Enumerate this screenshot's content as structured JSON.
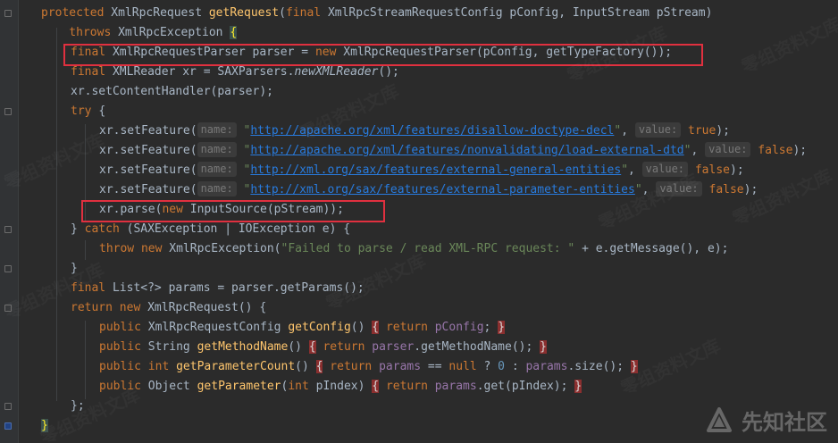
{
  "watermark_text": "零组资料文库",
  "logo_text": "先知社区",
  "lines": [
    [
      {
        "t": "protected ",
        "c": "kw"
      },
      {
        "t": "XmlRpcRequest "
      },
      {
        "t": "getRequest",
        "c": "fn"
      },
      {
        "t": "("
      },
      {
        "t": "final ",
        "c": "kw"
      },
      {
        "t": "XmlRpcStreamRequestConfig pConfig, InputStream pStream)"
      }
    ],
    [
      {
        "t": "    throws ",
        "c": "kw"
      },
      {
        "t": "XmlRpcException "
      },
      {
        "t": "{",
        "c": "brace-match"
      }
    ],
    [
      {
        "t": "final ",
        "c": "kw"
      },
      {
        "t": "XmlRpcRequestParser parser = "
      },
      {
        "t": "new ",
        "c": "kw"
      },
      {
        "t": "XmlRpcRequestParser(pConfig, getTypeFactory());"
      }
    ],
    [
      {
        "t": "final ",
        "c": "kw"
      },
      {
        "t": "XMLReader xr = SAXParsers."
      },
      {
        "t": "newXMLReader",
        "c": "italic"
      },
      {
        "t": "();"
      }
    ],
    [
      {
        "t": "xr.setContentHandler(parser);"
      }
    ],
    [
      {
        "t": "try ",
        "c": "kw"
      },
      {
        "t": "{"
      }
    ],
    [
      {
        "t": "xr.setFeature("
      },
      {
        "t": "name:",
        "hint": true
      },
      {
        "t": " "
      },
      {
        "t": "\"",
        "c": "str"
      },
      {
        "t": "http://apache.org/xml/features/disallow-doctype-decl",
        "c": "link"
      },
      {
        "t": "\"",
        "c": "str"
      },
      {
        "t": ", "
      },
      {
        "t": "value:",
        "hint": true
      },
      {
        "t": " "
      },
      {
        "t": "true",
        "c": "kw"
      },
      {
        "t": ");"
      }
    ],
    [
      {
        "t": "xr.setFeature("
      },
      {
        "t": "name:",
        "hint": true
      },
      {
        "t": " "
      },
      {
        "t": "\"",
        "c": "str"
      },
      {
        "t": "http://apache.org/xml/features/nonvalidating/load-external-dtd",
        "c": "link"
      },
      {
        "t": "\"",
        "c": "str"
      },
      {
        "t": ", "
      },
      {
        "t": "value:",
        "hint": true
      },
      {
        "t": " "
      },
      {
        "t": "false",
        "c": "kw"
      },
      {
        "t": ");"
      }
    ],
    [
      {
        "t": "xr.setFeature("
      },
      {
        "t": "name:",
        "hint": true
      },
      {
        "t": " "
      },
      {
        "t": "\"",
        "c": "str"
      },
      {
        "t": "http://xml.org/sax/features/external-general-entities",
        "c": "link"
      },
      {
        "t": "\"",
        "c": "str"
      },
      {
        "t": ", "
      },
      {
        "t": "value:",
        "hint": true
      },
      {
        "t": " "
      },
      {
        "t": "false",
        "c": "kw"
      },
      {
        "t": ");"
      }
    ],
    [
      {
        "t": "xr.setFeature("
      },
      {
        "t": "name:",
        "hint": true
      },
      {
        "t": " "
      },
      {
        "t": "\"",
        "c": "str"
      },
      {
        "t": "http://xml.org/sax/features/external-parameter-entities",
        "c": "link"
      },
      {
        "t": "\"",
        "c": "str"
      },
      {
        "t": ", "
      },
      {
        "t": "value:",
        "hint": true
      },
      {
        "t": " "
      },
      {
        "t": "false",
        "c": "kw"
      },
      {
        "t": ");"
      }
    ],
    [
      {
        "t": "xr.parse("
      },
      {
        "t": "new ",
        "c": "kw"
      },
      {
        "t": "InputSource(pStream));"
      }
    ],
    [
      {
        "t": "} "
      },
      {
        "t": "catch ",
        "c": "kw"
      },
      {
        "t": "(SAXException | IOException e) {"
      }
    ],
    [
      {
        "t": "throw new ",
        "c": "kw"
      },
      {
        "t": "XmlRpcException("
      },
      {
        "t": "\"Failed to parse / read XML-RPC request: \"",
        "c": "str"
      },
      {
        "t": " + e.getMessage(), e);"
      }
    ],
    [
      {
        "t": "}"
      }
    ],
    [
      {
        "t": "final ",
        "c": "kw"
      },
      {
        "t": "List<?> params = parser.getParams();"
      }
    ],
    [
      {
        "t": "return new ",
        "c": "kw"
      },
      {
        "t": "XmlRpcRequest() {"
      }
    ],
    [
      {
        "t": "public ",
        "c": "kw"
      },
      {
        "t": "XmlRpcRequestConfig "
      },
      {
        "t": "getConfig",
        "c": "fn"
      },
      {
        "t": "() "
      },
      {
        "t": "{",
        "c": "brace-hl"
      },
      {
        "t": " "
      },
      {
        "t": "return ",
        "c": "kw"
      },
      {
        "t": "pConfig",
        "c": "field"
      },
      {
        "t": "; "
      },
      {
        "t": "}",
        "c": "brace-hl"
      }
    ],
    [
      {
        "t": "public ",
        "c": "kw"
      },
      {
        "t": "String "
      },
      {
        "t": "getMethodName",
        "c": "fn"
      },
      {
        "t": "() "
      },
      {
        "t": "{",
        "c": "brace-hl"
      },
      {
        "t": " "
      },
      {
        "t": "return ",
        "c": "kw"
      },
      {
        "t": "parser",
        "c": "field"
      },
      {
        "t": ".getMethodName(); "
      },
      {
        "t": "}",
        "c": "brace-hl"
      }
    ],
    [
      {
        "t": "public int ",
        "c": "kw"
      },
      {
        "t": "getParameterCount",
        "c": "fn"
      },
      {
        "t": "() "
      },
      {
        "t": "{",
        "c": "brace-hl"
      },
      {
        "t": " "
      },
      {
        "t": "return ",
        "c": "kw"
      },
      {
        "t": "params",
        "c": "field"
      },
      {
        "t": " == "
      },
      {
        "t": "null ",
        "c": "kw"
      },
      {
        "t": "? "
      },
      {
        "t": "0",
        "c": "num"
      },
      {
        "t": " : "
      },
      {
        "t": "params",
        "c": "field"
      },
      {
        "t": ".size(); "
      },
      {
        "t": "}",
        "c": "brace-hl"
      }
    ],
    [
      {
        "t": "public ",
        "c": "kw"
      },
      {
        "t": "Object "
      },
      {
        "t": "getParameter",
        "c": "fn"
      },
      {
        "t": "("
      },
      {
        "t": "int ",
        "c": "kw"
      },
      {
        "t": "pIndex) "
      },
      {
        "t": "{",
        "c": "brace-hl"
      },
      {
        "t": " "
      },
      {
        "t": "return ",
        "c": "kw"
      },
      {
        "t": "params",
        "c": "field"
      },
      {
        "t": ".get(pIndex); "
      },
      {
        "t": "}",
        "c": "brace-hl"
      }
    ],
    [
      {
        "t": "};"
      }
    ],
    [
      {
        "t": "}",
        "c": "brace-match"
      }
    ]
  ]
}
